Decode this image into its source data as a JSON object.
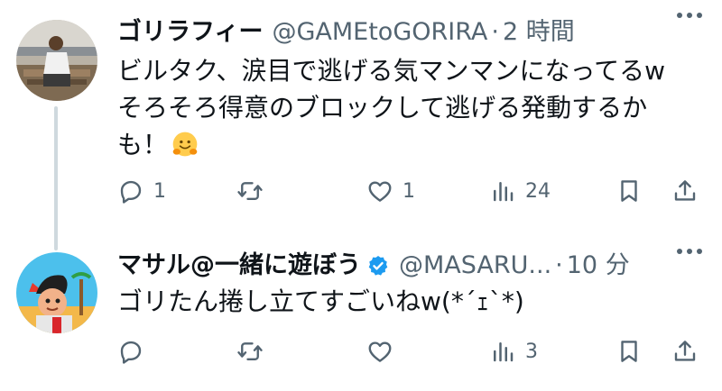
{
  "tweets": [
    {
      "author_name": "ゴリラフィー",
      "handle": "@GAMEtoGORIRA",
      "separator": "·",
      "time": "2 時間",
      "text": "ビルタク、涙目で逃げる気マンマンになってるw\nそろそろ得意のブロックして逃げる発動するか\nも！",
      "emoji": "hugging-face-emoji",
      "verified": false,
      "replies": "1",
      "retweets": "",
      "likes": "1",
      "views": "24"
    },
    {
      "author_name": "マサル@一緒に遊ぼう",
      "handle": "@MASARU...",
      "separator": "·",
      "time": "10 分",
      "text": "ゴリたん捲し立てすごいねw(*´ｪ`*)",
      "verified": true,
      "verified_color": "#1d9bf0",
      "replies": "",
      "retweets": "",
      "likes": "",
      "views": "3"
    }
  ],
  "colors": {
    "text": "#0f1419",
    "secondary": "#536471",
    "thread_line": "#cfd9de",
    "accent": "#1d9bf0"
  }
}
